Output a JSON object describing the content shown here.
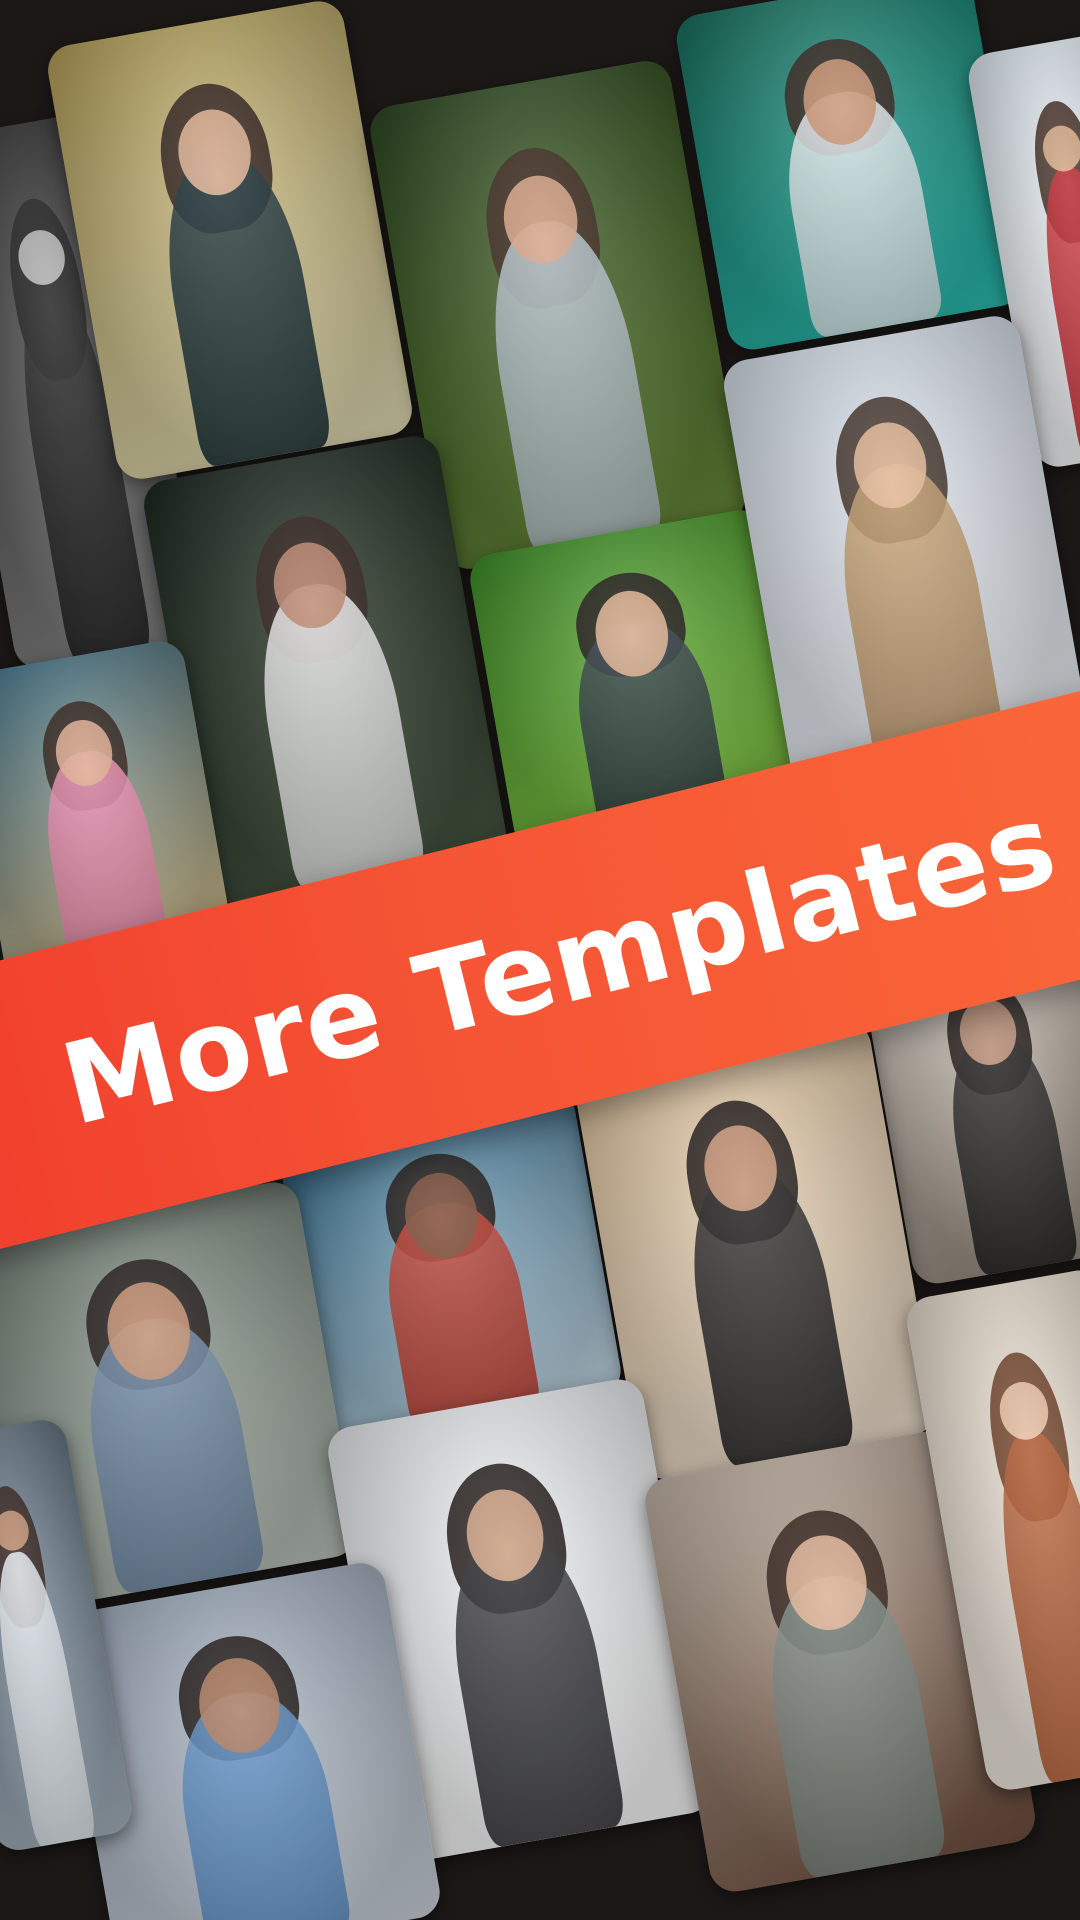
{
  "banner": {
    "title": "More Templates"
  },
  "colors": {
    "background": "#1b1816",
    "banner_start": "#f03a2b",
    "banner_end": "#fb6a3a",
    "banner_text": "#ffffff"
  },
  "collage": {
    "tiles": [
      {
        "name": "template-thumbnail-bw-portrait",
        "bg": [
          "#2a2a2a",
          "#8a8a8a"
        ],
        "skin": "#bdbdbd",
        "hair": "#1a1a1a",
        "cloth": "#202020"
      },
      {
        "name": "template-thumbnail-smiling-girl-cheeks",
        "bg": [
          "#b6a15a",
          "#e6e0b8"
        ],
        "skin": "#e2b090",
        "hair": "#2a1a14",
        "cloth": "#132b33"
      },
      {
        "name": "template-thumbnail-girl-braid-green",
        "bg": [
          "#2f4a25",
          "#6b8e3a"
        ],
        "skin": "#d9a283",
        "hair": "#3a2318",
        "cloth": "#b9c6cf"
      },
      {
        "name": "template-thumbnail-lagoon-boat",
        "bg": [
          "#1a6f5c",
          "#2cc4b8"
        ],
        "skin": "#c9906b",
        "hair": "#2a1a14",
        "cloth": "#e7eef2"
      },
      {
        "name": "template-thumbnail-hat-girl-red",
        "bg": [
          "#dde6ee",
          "#ffffff"
        ],
        "skin": "#e0b08c",
        "hair": "#3a2318",
        "cloth": "#c9222a"
      },
      {
        "name": "template-thumbnail-sunglasses-laughing",
        "bg": [
          "#1f2a22",
          "#4a5a44"
        ],
        "skin": "#b98066",
        "hair": "#2a1a14",
        "cloth": "#efefef"
      },
      {
        "name": "template-thumbnail-flowers-girl",
        "bg": [
          "#3f8f2a",
          "#8ccf4a"
        ],
        "skin": "#e2b28f",
        "hair": "#1a1210",
        "cloth": "#2e3b44"
      },
      {
        "name": "template-thumbnail-straw-hat-sea",
        "bg": [
          "#d7dfea",
          "#f2f5f9"
        ],
        "skin": "#e6b895",
        "hair": "#3b2a1f",
        "cloth": "#c69c6a"
      },
      {
        "name": "template-thumbnail-pink-shirt-girl",
        "bg": [
          "#3b6d86",
          "#e4c890"
        ],
        "skin": "#e0ab8d",
        "hair": "#2a1a14",
        "cloth": "#f08bb0"
      },
      {
        "name": "template-thumbnail-dotted-dress",
        "bg": [
          "#d8d0c5",
          "#8f8579"
        ],
        "skin": "#c2957a",
        "hair": "#1a1210",
        "cloth": "#1f1f1f"
      },
      {
        "name": "template-thumbnail-selfie-beach",
        "bg": [
          "#2f6a8a",
          "#cfe3ef"
        ],
        "skin": "#7a4a34",
        "hair": "#17100d",
        "cloth": "#c43b2b"
      },
      {
        "name": "template-thumbnail-leather-jacket",
        "bg": [
          "#e2c6a0",
          "#f4e6d4"
        ],
        "skin": "#d09a78",
        "hair": "#1a1210",
        "cloth": "#1d1d1f"
      },
      {
        "name": "template-thumbnail-peace-sign",
        "bg": [
          "#6d7a6e",
          "#bfc8bf"
        ],
        "skin": "#c8906f",
        "hair": "#1a1210",
        "cloth": "#6f8aa8"
      },
      {
        "name": "template-thumbnail-striped-shirt",
        "bg": [
          "#e9ebee",
          "#ffffff"
        ],
        "skin": "#d9a887",
        "hair": "#17100d",
        "cloth": "#2a2a2e"
      },
      {
        "name": "template-thumbnail-awesome-tee",
        "bg": [
          "#c7b9aa",
          "#6f4e3d"
        ],
        "skin": "#e4b696",
        "hair": "#2c1b12",
        "cloth": "#7d8a83"
      },
      {
        "name": "template-thumbnail-cartoon-girl",
        "bg": [
          "#e8dccd",
          "#f5efe7"
        ],
        "skin": "#f1c9ad",
        "hair": "#6a3a1e",
        "cloth": "#b6582c"
      },
      {
        "name": "template-thumbnail-red-truck",
        "bg": [
          "#9aa7b8",
          "#cfd6df"
        ],
        "skin": "#b07a5c",
        "hair": "#17100d",
        "cloth": "#5b8fc9"
      },
      {
        "name": "template-thumbnail-white-top-left",
        "bg": [
          "#5d6e7d",
          "#a9b6c2"
        ],
        "skin": "#c99373",
        "hair": "#2a1a14",
        "cloth": "#e9eef3"
      }
    ]
  }
}
